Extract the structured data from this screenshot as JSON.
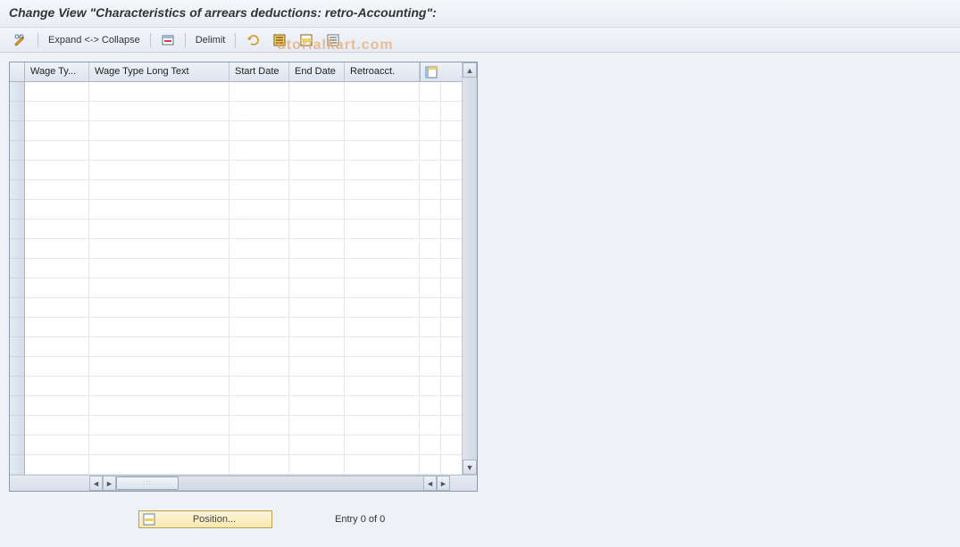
{
  "title": "Change View \"Characteristics of arrears deductions: retro-Accounting\":",
  "toolbar": {
    "expand_collapse": "Expand <-> Collapse",
    "delimit": "Delimit"
  },
  "watermark": "utorialkart.com",
  "table": {
    "columns": {
      "wage_type": "Wage Ty...",
      "long_text": "Wage Type Long Text",
      "start_date": "Start Date",
      "end_date": "End Date",
      "retroacct": "Retroacct."
    },
    "row_count": 20
  },
  "footer": {
    "position_label": "Position...",
    "entry_text": "Entry 0 of 0"
  }
}
